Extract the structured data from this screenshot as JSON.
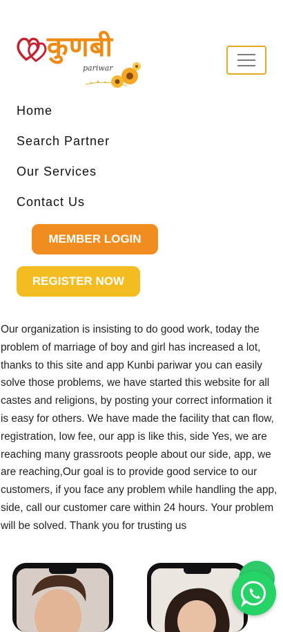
{
  "logo": {
    "title": "कुणबी",
    "subtitle": "pariwar",
    "icon": "hearts-logo-icon",
    "brand_color": "#ef8b12"
  },
  "header": {
    "menu_icon": "hamburger-menu-icon",
    "menu_border_color": "#e0a91e"
  },
  "nav": {
    "items": [
      "Home",
      "Search Partner",
      "Our Services",
      "Contact Us"
    ]
  },
  "buttons": {
    "member_login": "MEMBER LOGIN",
    "register_now": "REGISTER NOW",
    "login_color": "#f18d1e",
    "register_color": "#f3bd22"
  },
  "about": {
    "text": "Our organization is insisting to do good work, today the problem of marriage of boy and girl has increased a lot, thanks to this site and app Kunbi pariwar you can easily solve those problems, we have started this website for all castes and religions, by posting your correct information it is easy for others. We have made the facility that can flow, registration, low fee, our app is like this, side Yes, we are reaching many grassroots people about our side, app, we are reaching,Our goal is to provide good service to our customers, if you face any problem while handling the app, side, call our customer care within 24 hours. Your problem will be solved. Thank you for trusting us"
  },
  "whatsapp": {
    "icon": "whatsapp-icon",
    "color": "#25d366"
  }
}
